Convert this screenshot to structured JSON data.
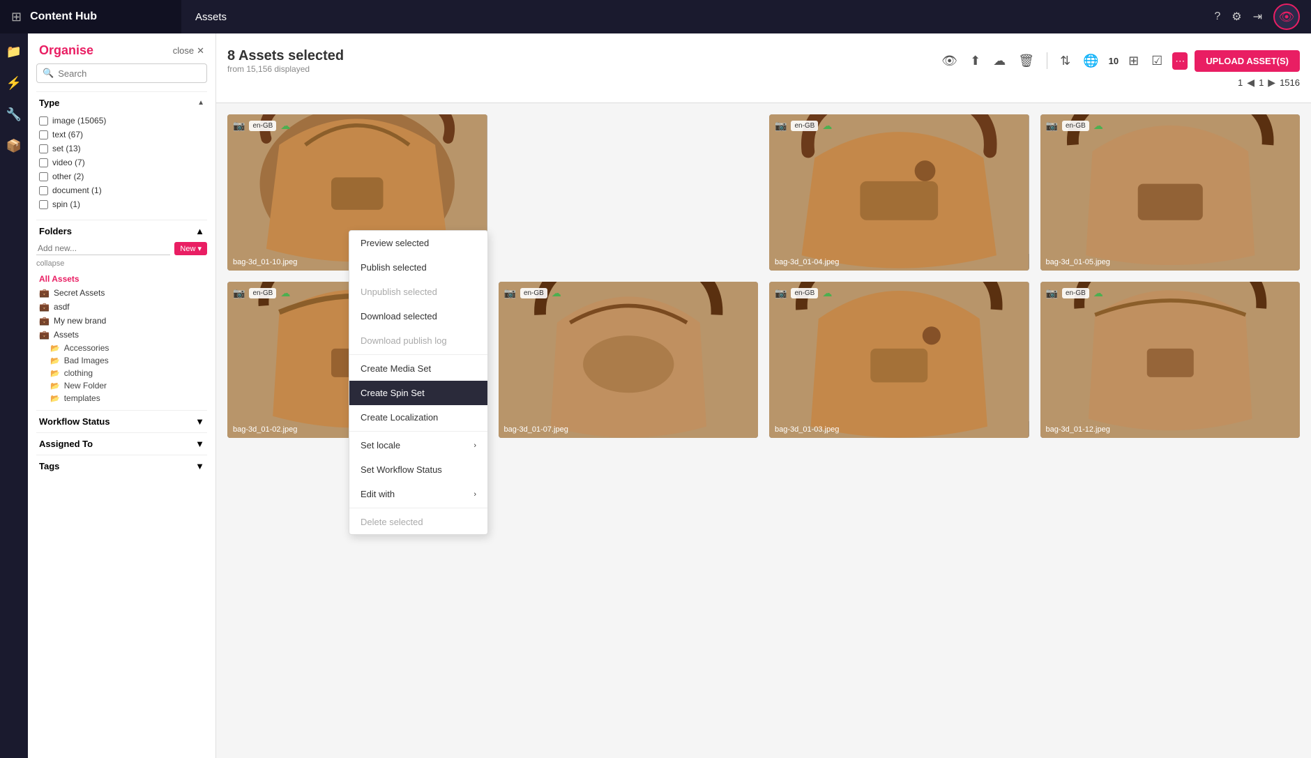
{
  "app": {
    "title": "Content Hub",
    "section": "Assets"
  },
  "topnav": {
    "icons": [
      "help-icon",
      "settings-icon",
      "logout-icon"
    ],
    "avatar_icon": "👁"
  },
  "organise": {
    "title": "Organise",
    "close_label": "close",
    "search_placeholder": "Search"
  },
  "type_filter": {
    "header": "Type",
    "items": [
      {
        "label": "image (15065)"
      },
      {
        "label": "text (67)"
      },
      {
        "label": "set (13)"
      },
      {
        "label": "video (7)"
      },
      {
        "label": "other (2)"
      },
      {
        "label": "document (1)"
      },
      {
        "label": "spin (1)"
      }
    ]
  },
  "folders": {
    "header": "Folders",
    "add_placeholder": "Add new...",
    "new_label": "New ▾",
    "collapse_label": "collapse",
    "all_assets_label": "All Assets",
    "items": [
      {
        "label": "Secret Assets",
        "icon": "briefcase"
      },
      {
        "label": "asdf",
        "icon": "briefcase"
      },
      {
        "label": "My new brand",
        "icon": "briefcase"
      },
      {
        "label": "Assets",
        "icon": "briefcase",
        "children": [
          {
            "label": "Accessories"
          },
          {
            "label": "Bad Images"
          },
          {
            "label": "clothing"
          },
          {
            "label": "New Folder"
          },
          {
            "label": "templates"
          }
        ]
      }
    ]
  },
  "workflow_status": {
    "header": "Workflow Status"
  },
  "assigned_to": {
    "header": "Assigned To"
  },
  "tags": {
    "header": "Tags"
  },
  "toolbar": {
    "selected_count": "8 Assets selected",
    "from_displayed": "from 15,156 displayed",
    "upload_label": "UPLOAD ASSET(S)",
    "view_number": "10",
    "page_current": "1",
    "page_total": "1516"
  },
  "context_menu": {
    "items": [
      {
        "label": "Preview selected",
        "disabled": false,
        "has_sub": false,
        "highlighted": false
      },
      {
        "label": "Publish selected",
        "disabled": false,
        "has_sub": false,
        "highlighted": false
      },
      {
        "label": "Unpublish selected",
        "disabled": true,
        "has_sub": false,
        "highlighted": false
      },
      {
        "label": "Download selected",
        "disabled": false,
        "has_sub": false,
        "highlighted": false
      },
      {
        "label": "Download publish log",
        "disabled": true,
        "has_sub": false,
        "highlighted": false
      },
      {
        "label": "Create Media Set",
        "disabled": false,
        "has_sub": false,
        "highlighted": false
      },
      {
        "label": "Create Spin Set",
        "disabled": false,
        "has_sub": false,
        "highlighted": true
      },
      {
        "label": "Create Localization",
        "disabled": false,
        "has_sub": false,
        "highlighted": false
      },
      {
        "label": "Set locale",
        "disabled": false,
        "has_sub": true,
        "highlighted": false
      },
      {
        "label": "Set Workflow Status",
        "disabled": false,
        "has_sub": false,
        "highlighted": false
      },
      {
        "label": "Edit with",
        "disabled": false,
        "has_sub": true,
        "highlighted": false
      },
      {
        "label": "Delete selected",
        "disabled": true,
        "has_sub": false,
        "highlighted": false
      }
    ]
  },
  "assets": [
    {
      "id": 1,
      "name": "bag-3d_01-10.jpeg",
      "lang": "en-GB"
    },
    {
      "id": 2,
      "name": "bag-3d_01-02.jpeg",
      "lang": "en-GB"
    },
    {
      "id": 3,
      "name": "bag-3d_01-04.jpeg",
      "lang": "en-GB"
    },
    {
      "id": 4,
      "name": "bag-3d_01-05.jpeg",
      "lang": "en-GB"
    },
    {
      "id": 5,
      "name": "bag-3d_01-07.jpeg",
      "lang": "en-GB"
    },
    {
      "id": 6,
      "name": "bag-3d_01-03.jpeg",
      "lang": "en-GB"
    },
    {
      "id": 7,
      "name": "bag-3d_01-12.jpeg",
      "lang": "en-GB"
    }
  ]
}
